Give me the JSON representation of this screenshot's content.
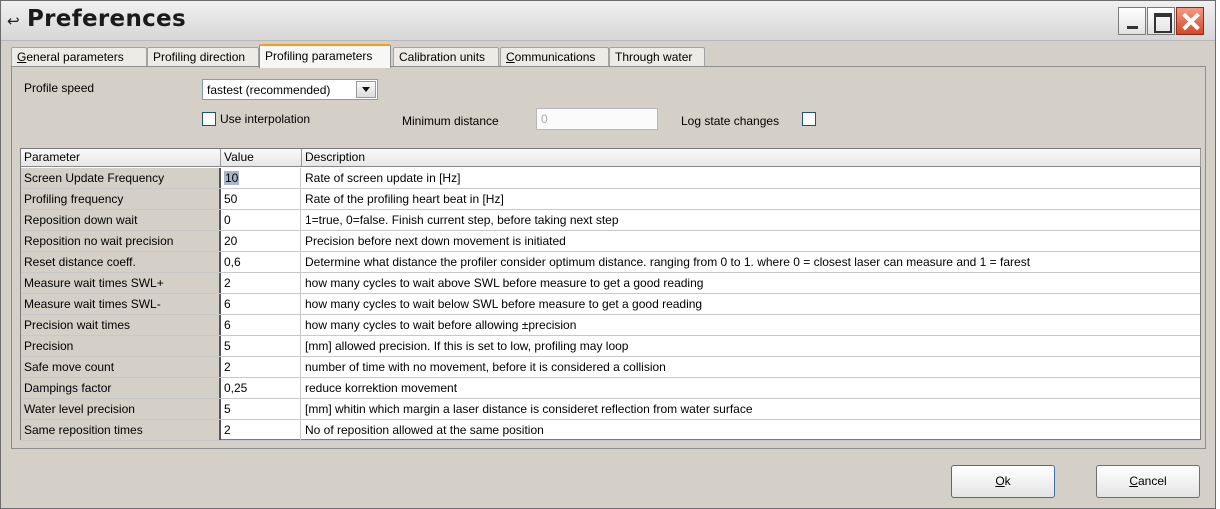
{
  "window": {
    "title": "Preferences",
    "icon": "app-icon"
  },
  "tabs": [
    {
      "label": "General parameters",
      "mnemonic": "G",
      "rest": "eneral parameters",
      "active": false
    },
    {
      "label": "Profiling direction",
      "active": false
    },
    {
      "label": "Profiling parameters",
      "active": true
    },
    {
      "label": "Calibration units",
      "active": false
    },
    {
      "label": "Communications",
      "mnemonic": "C",
      "rest": "ommunications",
      "active": false
    },
    {
      "label": "Through water",
      "active": false
    }
  ],
  "settings": {
    "profile_speed_label": "Profile speed",
    "profile_speed_value": "fastest (recommended)",
    "use_interpolation_label": "Use interpolation",
    "use_interpolation_checked": false,
    "minimum_distance_label": "Minimum distance",
    "minimum_distance_value": "0",
    "log_state_changes_label": "Log state changes",
    "log_state_changes_checked": false
  },
  "table": {
    "columns": [
      "Parameter",
      "Value",
      "Description"
    ],
    "rows": [
      {
        "parameter": "Screen Update Frequency",
        "value": "10",
        "description": "Rate of screen update in [Hz]"
      },
      {
        "parameter": "Profiling frequency",
        "value": "50",
        "description": "Rate of the profiling heart beat in [Hz]"
      },
      {
        "parameter": "Reposition down wait",
        "value": "0",
        "description": "1=true, 0=false. Finish current step, before taking next step"
      },
      {
        "parameter": "Reposition no wait precision",
        "value": "20",
        "description": "Precision before next down movement is initiated"
      },
      {
        "parameter": "Reset distance coeff.",
        "value": "0,6",
        "description": "Determine what distance the profiler consider optimum distance. ranging from 0 to 1.  where 0 = closest laser can measure and 1 = farest"
      },
      {
        "parameter": "Measure wait times SWL+",
        "value": "2",
        "description": "how many cycles to wait above SWL before measure to get a good reading"
      },
      {
        "parameter": "Measure wait times SWL-",
        "value": "6",
        "description": "how many cycles to wait below SWL before measure to get a good reading"
      },
      {
        "parameter": "Precision wait times",
        "value": "6",
        "description": "how many cycles to wait before allowing ±precision"
      },
      {
        "parameter": "Precision",
        "value": "5",
        "description": "[mm] allowed precision. If this is set to low, profiling may loop"
      },
      {
        "parameter": "Safe move count",
        "value": "2",
        "description": "number of time with no movement, before it is considered a collision"
      },
      {
        "parameter": "Dampings factor",
        "value": "0,25",
        "description": "reduce korrektion movement"
      },
      {
        "parameter": "Water level precision",
        "value": "5",
        "description": "[mm] whitin which margin a laser distance is consideret reflection from water surface"
      },
      {
        "parameter": "Same reposition times",
        "value": "2",
        "description": "No of reposition allowed at the same position"
      }
    ]
  },
  "buttons": {
    "ok_mnemonic": "O",
    "ok_rest": "k",
    "cancel_mnemonic": "C",
    "cancel_rest": "ancel"
  }
}
